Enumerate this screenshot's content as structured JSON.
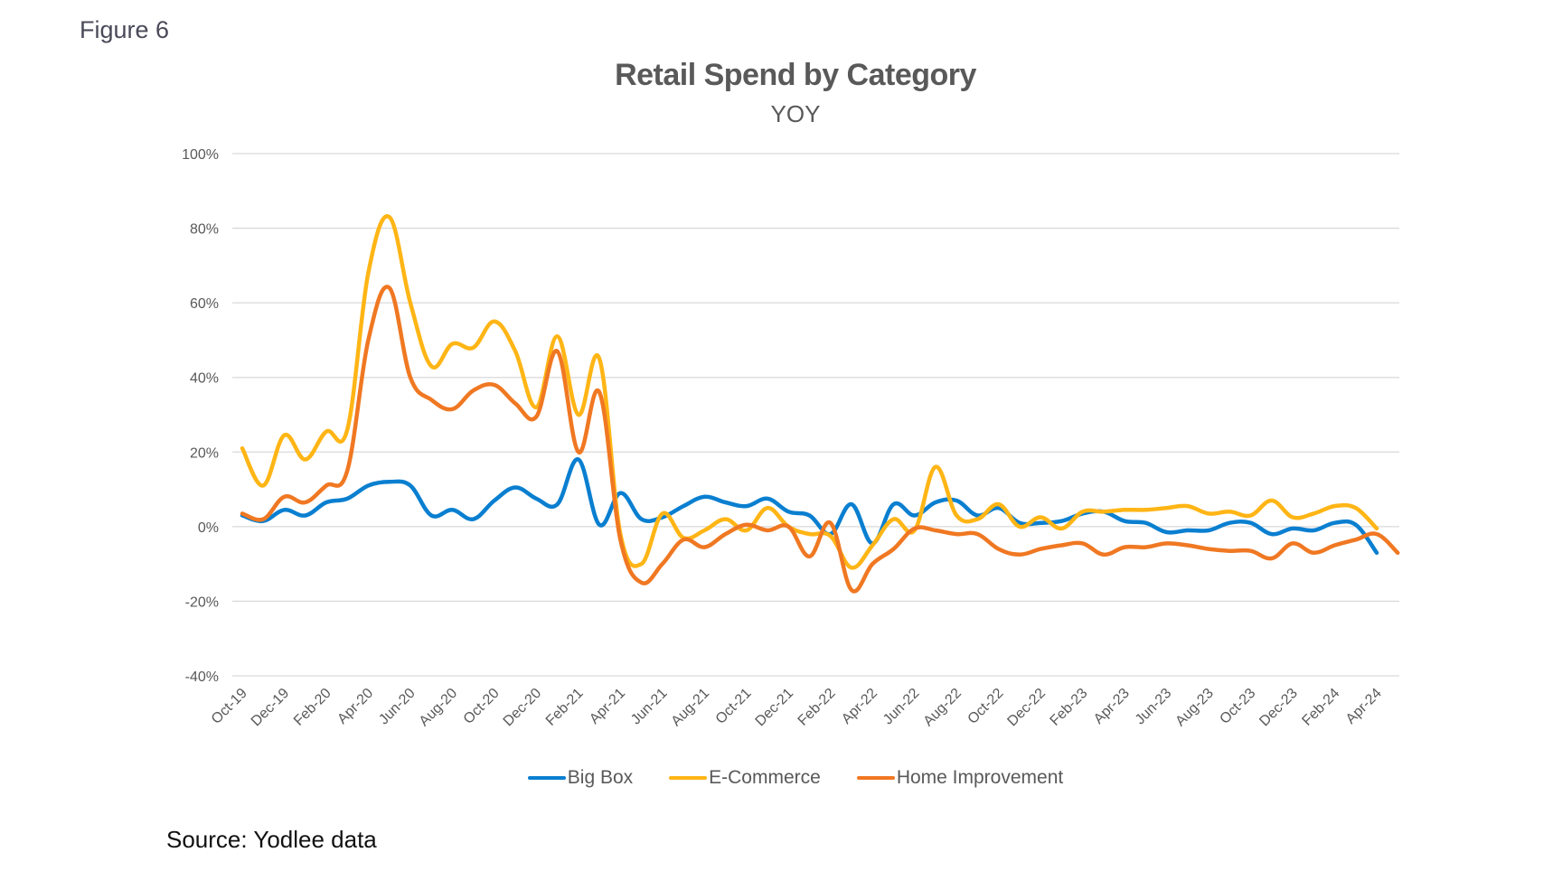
{
  "figure_label": "Figure 6",
  "source": "Source: Yodlee data",
  "chart_data": {
    "type": "line",
    "title": "Retail Spend by Category",
    "subtitle": "YOY",
    "xlabel": "",
    "ylabel": "",
    "ylim": [
      -40,
      100
    ],
    "yticks": [
      -40,
      -20,
      0,
      20,
      40,
      60,
      80,
      100
    ],
    "ytick_labels": [
      "-40%",
      "-20%",
      "0%",
      "20%",
      "40%",
      "60%",
      "80%",
      "100%"
    ],
    "grid": true,
    "legend_position": "bottom",
    "x": [
      "Oct-19",
      "Nov-19",
      "Dec-19",
      "Jan-20",
      "Feb-20",
      "Mar-20",
      "Apr-20",
      "May-20",
      "Jun-20",
      "Jul-20",
      "Aug-20",
      "Sep-20",
      "Oct-20",
      "Nov-20",
      "Dec-20",
      "Jan-21",
      "Feb-21",
      "Mar-21",
      "Apr-21",
      "May-21",
      "Jun-21",
      "Jul-21",
      "Aug-21",
      "Sep-21",
      "Oct-21",
      "Nov-21",
      "Dec-21",
      "Jan-22",
      "Feb-22",
      "Mar-22",
      "Apr-22",
      "May-22",
      "Jun-22",
      "Jul-22",
      "Aug-22",
      "Sep-22",
      "Oct-22",
      "Nov-22",
      "Dec-22",
      "Jan-23",
      "Feb-23",
      "Mar-23",
      "Apr-23",
      "May-23",
      "Jun-23",
      "Jul-23",
      "Aug-23",
      "Sep-23",
      "Oct-23",
      "Nov-23",
      "Dec-23",
      "Jan-24",
      "Feb-24",
      "Mar-24",
      "Apr-24"
    ],
    "xtick_labels": [
      "Oct-19",
      "Dec-19",
      "Feb-20",
      "Apr-20",
      "Jun-20",
      "Aug-20",
      "Oct-20",
      "Dec-20",
      "Feb-21",
      "Apr-21",
      "Jun-21",
      "Aug-21",
      "Oct-21",
      "Dec-21",
      "Feb-22",
      "Apr-22",
      "Jun-22",
      "Aug-22",
      "Oct-22",
      "Dec-22",
      "Feb-23",
      "Apr-23",
      "Jun-23",
      "Aug-23",
      "Oct-23",
      "Dec-23",
      "Feb-24",
      "Apr-24"
    ],
    "series": [
      {
        "name": "Big Box",
        "color": "#0a7fd0",
        "values": [
          3,
          1.5,
          4.5,
          3,
          6.5,
          7.5,
          11,
          12,
          11,
          3,
          4.5,
          2,
          7,
          10.5,
          7.5,
          6,
          18,
          0.5,
          9,
          2,
          2.5,
          5.5,
          8,
          6.5,
          5.5,
          7.5,
          4,
          3,
          -2,
          6,
          -4.5,
          6,
          3,
          6.5,
          7,
          3,
          5,
          1,
          1,
          1.5,
          3.5,
          4,
          1.5,
          1,
          -1.5,
          -1,
          -1,
          1,
          1,
          -2,
          -0.5,
          -1,
          1,
          0.5,
          -7
        ]
      },
      {
        "name": "E-Commerce",
        "color": "#ffb515",
        "values": [
          21,
          11,
          24.5,
          18,
          25.5,
          26,
          68,
          83,
          60,
          43,
          49,
          48,
          55,
          47,
          32,
          51,
          30,
          45,
          -2,
          -10,
          3.5,
          -3,
          -1,
          2,
          -1,
          5,
          0,
          -2,
          -2.5,
          -11,
          -5,
          2,
          -1,
          16,
          3,
          2,
          6,
          0,
          2.5,
          -0.5,
          4,
          4,
          4.5,
          4.5,
          5,
          5.5,
          3.5,
          4,
          3,
          7,
          2.5,
          3.5,
          5.5,
          5,
          -0.5
        ]
      },
      {
        "name": "Home Improvement",
        "color": "#f07822",
        "values": [
          3.5,
          2,
          8,
          6.5,
          11,
          15,
          50,
          64,
          40,
          34,
          31.5,
          36.5,
          38,
          33,
          29.5,
          47,
          20,
          36,
          -3.5,
          -15,
          -10,
          -3.5,
          -5.5,
          -2,
          0.5,
          -1,
          0,
          -8,
          1,
          -17,
          -10,
          -6,
          -0.5,
          -1,
          -2,
          -2,
          -6,
          -7.5,
          -6,
          -5,
          -4.5,
          -7.5,
          -5.5,
          -5.5,
          -4.5,
          -5,
          -6,
          -6.5,
          -6.5,
          -8.5,
          -4.5,
          -7,
          -5,
          -3.5,
          -2,
          -7
        ]
      }
    ]
  }
}
